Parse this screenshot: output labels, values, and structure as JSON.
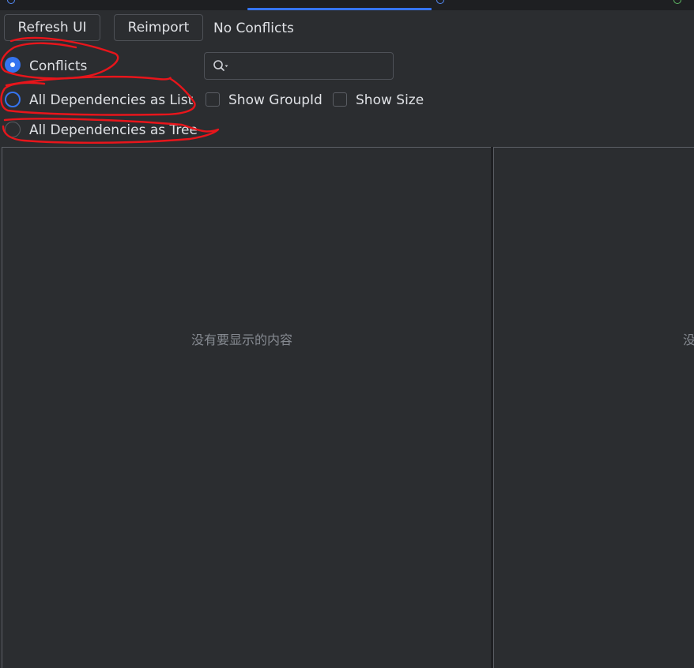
{
  "toolbar": {
    "refresh_label": "Refresh UI",
    "reimport_label": "Reimport",
    "status_text": "No Conflicts"
  },
  "view_mode": {
    "options": [
      {
        "label": "Conflicts",
        "selected": true
      },
      {
        "label": "All Dependencies as List",
        "selected": false
      },
      {
        "label": "All Dependencies as Tree",
        "selected": false
      }
    ]
  },
  "search": {
    "value": "",
    "placeholder": "",
    "icon": "search-icon"
  },
  "options": {
    "show_groupid_label": "Show GroupId",
    "show_groupid_checked": false,
    "show_size_label": "Show Size",
    "show_size_checked": false
  },
  "panels": {
    "left_empty_text": "没有要显示的内容",
    "right_empty_text": "没"
  },
  "colors": {
    "accent": "#3574f0",
    "background": "#2b2d30",
    "annotation": "#e8151b"
  }
}
